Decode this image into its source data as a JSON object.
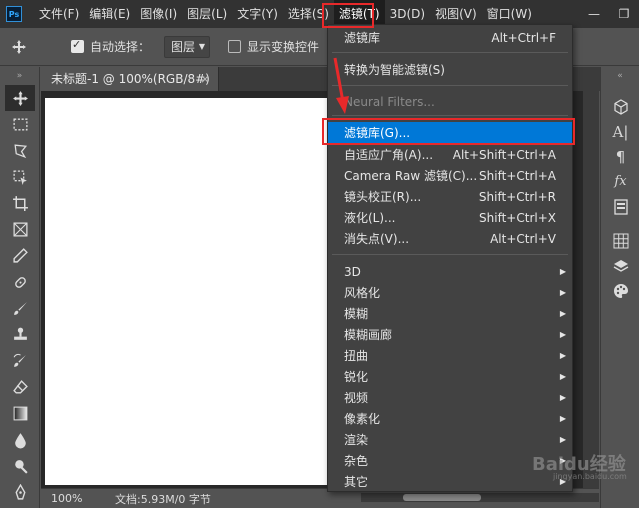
{
  "app_logo": "Ps",
  "menu": [
    {
      "label": "文件(F)"
    },
    {
      "label": "编辑(E)"
    },
    {
      "label": "图像(I)"
    },
    {
      "label": "图层(L)"
    },
    {
      "label": "文字(Y)"
    },
    {
      "label": "选择(S)"
    },
    {
      "label": "滤镜(T)"
    },
    {
      "label": "3D(D)"
    },
    {
      "label": "视图(V)"
    },
    {
      "label": "窗口(W)"
    }
  ],
  "window_controls": {
    "minimize": "—",
    "restore": "❐",
    "close": "✕"
  },
  "options_bar": {
    "auto_select_label": "自动选择：",
    "auto_select_checked": true,
    "layer_select_value": "图层",
    "show_transform_label": "显示变换控件",
    "show_transform_checked": false
  },
  "document": {
    "tab_title": "未标题-1 @ 100%(RGB/8#)",
    "close_glyph": "×",
    "zoom": "100%",
    "doc_info": "文档:5.93M/0 字节"
  },
  "filter_menu": {
    "items": [
      {
        "label": "滤镜库",
        "shortcut": "Alt+Ctrl+F"
      },
      {
        "label": "转换为智能滤镜(S)",
        "shortcut": ""
      },
      {
        "label": "Neural Filters...",
        "shortcut": "",
        "disabled": true
      },
      {
        "label": "滤镜库(G)...",
        "shortcut": "",
        "highlighted": true
      },
      {
        "label": "自适应广角(A)...",
        "shortcut": "Alt+Shift+Ctrl+A"
      },
      {
        "label": "Camera Raw 滤镜(C)...",
        "shortcut": "Shift+Ctrl+A"
      },
      {
        "label": "镜头校正(R)...",
        "shortcut": "Shift+Ctrl+R"
      },
      {
        "label": "液化(L)...",
        "shortcut": "Shift+Ctrl+X"
      },
      {
        "label": "消失点(V)...",
        "shortcut": "Alt+Ctrl+V"
      },
      {
        "label": "3D",
        "submenu": true
      },
      {
        "label": "风格化",
        "submenu": true
      },
      {
        "label": "模糊",
        "submenu": true
      },
      {
        "label": "模糊画廊",
        "submenu": true
      },
      {
        "label": "扭曲",
        "submenu": true
      },
      {
        "label": "锐化",
        "submenu": true
      },
      {
        "label": "视频",
        "submenu": true
      },
      {
        "label": "像素化",
        "submenu": true
      },
      {
        "label": "渲染",
        "submenu": true
      },
      {
        "label": "杂色",
        "submenu": true
      },
      {
        "label": "其它",
        "submenu": true
      }
    ]
  },
  "watermark": {
    "text": "Baidu经验",
    "sub": "jingyan.baidu.com"
  },
  "colors": {
    "highlight": "#0078d7",
    "annotation_red": "#e8292a",
    "menubar": "#323232",
    "panel": "#535353"
  },
  "tools": [
    "move-icon",
    "marquee-icon",
    "lasso-icon",
    "object-select-icon",
    "crop-icon",
    "frame-icon",
    "eyedropper-icon",
    "healing-brush-icon",
    "brush-icon",
    "clone-stamp-icon",
    "history-brush-icon",
    "eraser-icon",
    "gradient-icon",
    "blur-icon",
    "dodge-icon",
    "pen-icon"
  ],
  "right_panel_icons": [
    "3d-cube-icon",
    "character-icon",
    "paragraph-icon",
    "glyphs-icon",
    "properties-icon",
    "grid-icon",
    "layers-icon",
    "palette-icon"
  ]
}
